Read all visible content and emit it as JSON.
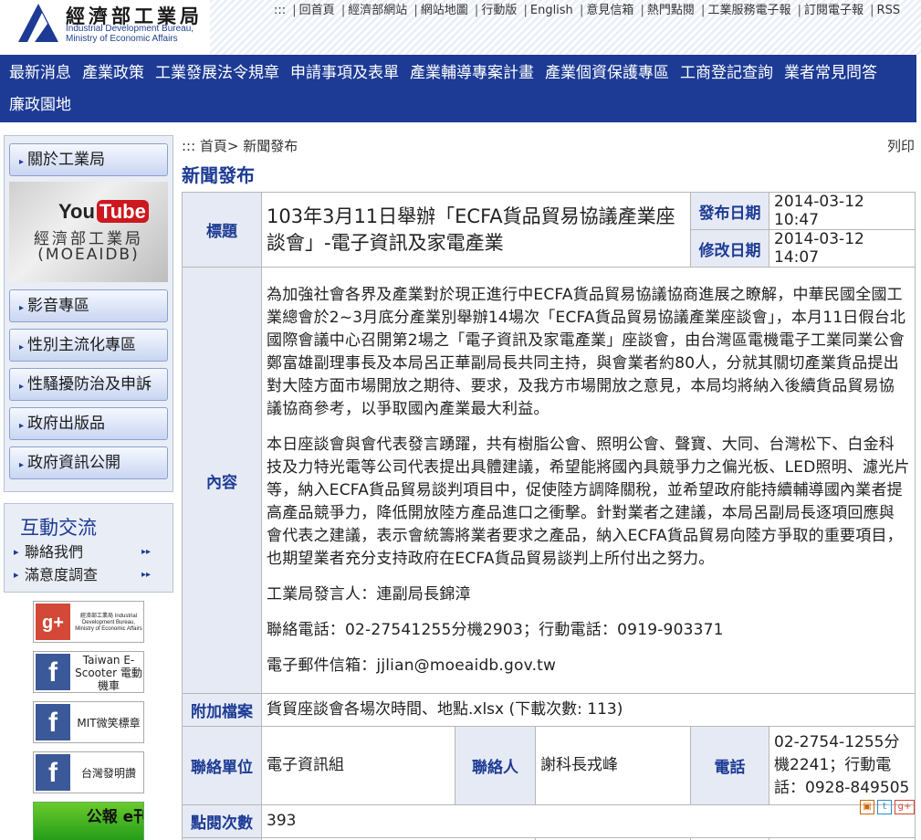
{
  "header": {
    "logo_zh": "經濟部工業局",
    "logo_en_line1": "Industrial Development Bureau,",
    "logo_en_line2": "Ministry of Economic Affairs",
    "toplinks_prefix": ":::",
    "toplinks": [
      "回首頁",
      "經濟部網站",
      "網站地圖",
      "行動版",
      "English",
      "意見信箱",
      "熱門點閱",
      "工業服務電子報",
      "訂閱電子報",
      "RSS"
    ]
  },
  "mainnav": [
    "最新消息",
    "產業政策",
    "工業發展法令規章",
    "申請事項及表單",
    "產業輔導專案計畫",
    "產業個資保護專區",
    "工商登記查詢",
    "業者常見問答",
    "廉政園地"
  ],
  "sidebar": {
    "top_item": "關於工業局",
    "youtube": {
      "brand_you": "You",
      "brand_tube": "Tube",
      "name": "經濟部工業局",
      "handle": "(MOEAIDB)"
    },
    "items": [
      "影音專區",
      "性別主流化專區",
      "性騷擾防治及申訴",
      "政府出版品",
      "政府資訊公開"
    ],
    "interact_title": "互動交流",
    "interact_items": [
      "聯絡我們",
      "滿意度調查"
    ],
    "social": [
      {
        "icon": "g+",
        "label": "經濟部工業局 Industrial Development Bureau, Ministry of Economic Affairs"
      },
      {
        "icon": "f",
        "label": "Taiwan E-Scooter 電動機車"
      },
      {
        "icon": "f",
        "label": "MIT微笑標章"
      },
      {
        "icon": "f",
        "label": "台灣發明讚"
      },
      {
        "icon": "",
        "label": "公報 e刊"
      }
    ]
  },
  "content": {
    "breadcrumb": "::: 首頁> 新聞發布",
    "print": "列印",
    "page_title": "新聞發布",
    "labels": {
      "title": "標題",
      "publish_date": "發布日期",
      "modify_date": "修改日期",
      "body": "內容",
      "attachment": "附加檔案",
      "unit": "聯絡單位",
      "contact": "聯絡人",
      "phone": "電話",
      "views": "點閱次數"
    },
    "title": "103年3月11日舉辦「ECFA貨品貿易協議產業座談會」-電子資訊及家電產業",
    "publish_date": "2014-03-12 10:47",
    "modify_date": "2014-03-12 14:07",
    "paragraphs": [
      "為加強社會各界及產業對於現正進行中ECFA貨品貿易協議協商進展之瞭解，中華民國全國工業總會於2~3月底分產業別舉辦14場次「ECFA貨品貿易協議產業座談會」，本月11日假台北國際會議中心召開第2場之「電子資訊及家電產業」座談會，由台灣區電機電子工業同業公會鄭富雄副理事長及本局呂正華副局長共同主持，與會業者約80人，分就其關切產業貨品提出對大陸方面市場開放之期待、要求，及我方市場開放之意見，本局均將納入後續貨品貿易協議協商參考，以爭取國內產業最大利益。",
      "本日座談會與會代表發言踴躍，共有樹脂公會、照明公會、聲寶、大同、台灣松下、白金科技及力特光電等公司代表提出具體建議，希望能將國內具競爭力之偏光板、LED照明、濾光片等，納入ECFA貨品貿易談判項目中，促使陸方調降關稅，並希望政府能持續輔導國內業者提高產品競爭力，降低開放陸方產品進口之衝擊。針對業者之建議，本局呂副局長逐項回應與會代表之建議，表示會統籌將業者要求之產品，納入ECFA貨品貿易向陸方爭取的重要項目，也期望業者充分支持政府在ECFA貨品貿易談判上所付出之努力。",
      "工業局發言人：連副局長錦漳",
      "聯絡電話：02-27541255分機2903；行動電話：0919-903371",
      "電子郵件信箱：jjlian@moeaidb.gov.tw"
    ],
    "attachment": "貨貿座談會各場次時間、地點.xlsx (下載次數: 113)",
    "unit": "電子資訊組",
    "contact": "謝科長戎峰",
    "phone": "02-2754-1255分機2241；行動電話：0928-849505",
    "views": "393"
  },
  "colors": {
    "brand": "#1d3b94",
    "label_bg": "#e6eaf4"
  }
}
